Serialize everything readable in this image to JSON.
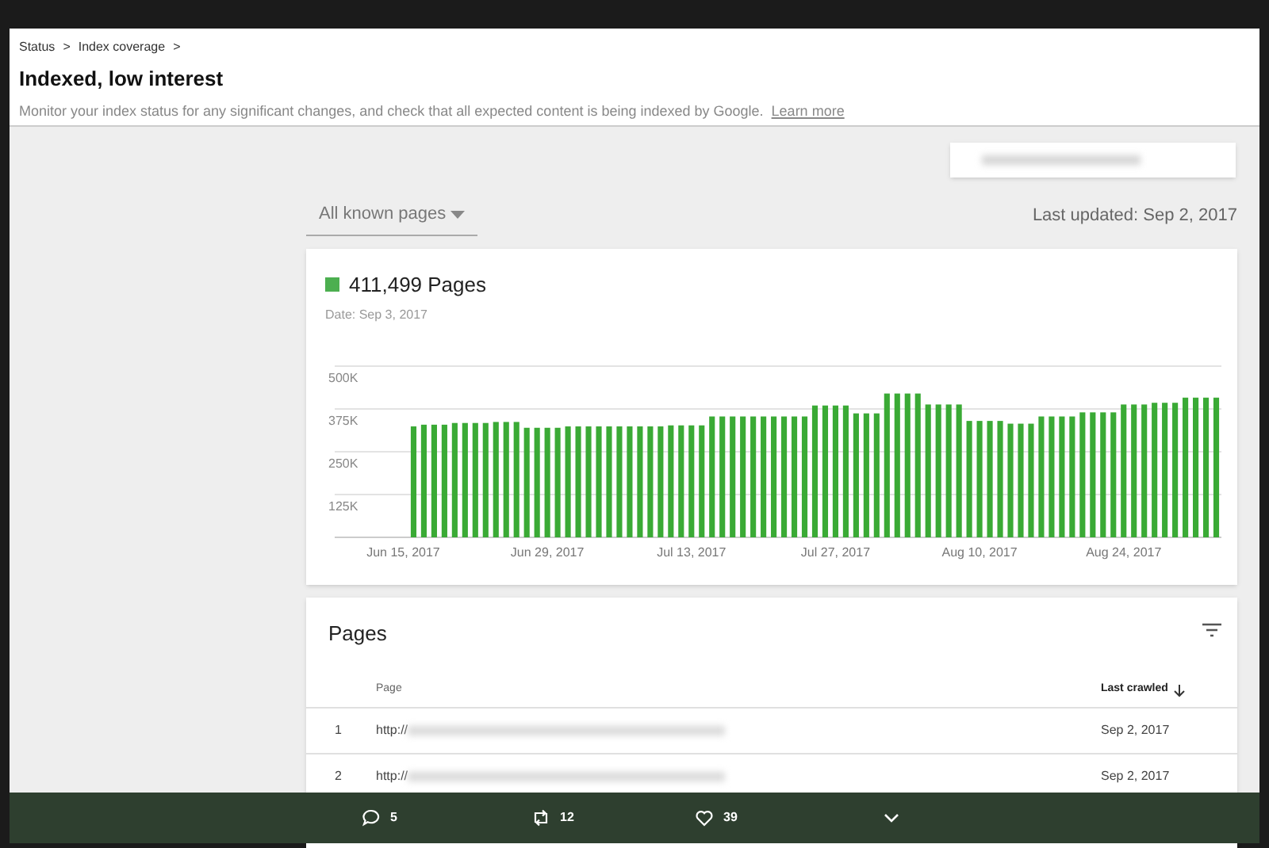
{
  "breadcrumb": [
    "Status",
    "Index coverage"
  ],
  "breadcrumb_separator": ">",
  "title": "Indexed, low interest",
  "description": "Monitor your index status for any significant changes, and check that all expected content is being indexed by Google.",
  "learn_more": "Learn more",
  "filter_dropdown": {
    "value": "All known pages"
  },
  "last_updated": "Last updated: Sep 2, 2017",
  "summary": {
    "count": "411,499 Pages",
    "color": "#4caf50",
    "date": "Date: Sep 3, 2017",
    "chart_data": {
      "type": "bar",
      "grid": true,
      "ylim": [
        0,
        500000
      ],
      "categories": [
        "Jun 15, 2017",
        null,
        null,
        null,
        null,
        null,
        null,
        null,
        null,
        null,
        null,
        null,
        null,
        null,
        "Jun 29, 2017",
        null,
        null,
        null,
        null,
        null,
        null,
        null,
        null,
        null,
        null,
        null,
        null,
        null,
        "Jul 13, 2017",
        null,
        null,
        null,
        null,
        null,
        null,
        null,
        null,
        null,
        null,
        null,
        null,
        null,
        "Jul 27, 2017",
        null,
        null,
        null,
        null,
        null,
        null,
        null,
        null,
        null,
        null,
        null,
        null,
        null,
        "Aug 10, 2017",
        null,
        null,
        null,
        null,
        null,
        null,
        null,
        null,
        null,
        null,
        null,
        null,
        null,
        "Aug 24, 2017",
        null,
        null,
        null,
        null,
        null,
        null,
        null,
        null,
        null
      ],
      "yticks": [
        {
          "value": 125000,
          "label": "125K"
        },
        {
          "value": 250000,
          "label": "250K"
        },
        {
          "value": 375000,
          "label": "375K"
        },
        {
          "value": 500000,
          "label": "500K"
        }
      ],
      "series": [
        {
          "color": "#3aaa35",
          "values": [
            null,
            324000,
            329000,
            329000,
            329000,
            334000,
            334000,
            334000,
            334000,
            337000,
            337000,
            337000,
            320000,
            320000,
            320000,
            320000,
            324000,
            324000,
            324000,
            324000,
            324000,
            324000,
            324000,
            324000,
            324000,
            324000,
            327000,
            327000,
            327000,
            327000,
            353000,
            353000,
            353000,
            353000,
            353000,
            353000,
            353000,
            353000,
            353000,
            353000,
            385000,
            385000,
            385000,
            385000,
            362000,
            362000,
            362000,
            420000,
            420000,
            420000,
            420000,
            388000,
            388000,
            388000,
            388000,
            340000,
            340000,
            340000,
            340000,
            332000,
            332000,
            332000,
            353000,
            353000,
            353000,
            353000,
            365000,
            365000,
            365000,
            365000,
            388000,
            388000,
            388000,
            393000,
            393000,
            393000,
            408000,
            408000,
            408000,
            408000
          ]
        }
      ]
    }
  },
  "pages_table": {
    "title": "Pages",
    "columns": [
      {
        "label": "Page",
        "sorted": false
      },
      {
        "label": "Last crawled",
        "sorted": true
      }
    ],
    "rows": [
      {
        "index": "1",
        "page": "http://",
        "last_crawled": "Sep 2, 2017"
      },
      {
        "index": "2",
        "page": "http://",
        "last_crawled": "Sep 2, 2017"
      }
    ]
  },
  "tweet_actions": [
    {
      "kind": "reply",
      "count": "5"
    },
    {
      "kind": "retweet",
      "count": "12"
    },
    {
      "kind": "like",
      "count": "39"
    },
    {
      "kind": "more"
    }
  ]
}
